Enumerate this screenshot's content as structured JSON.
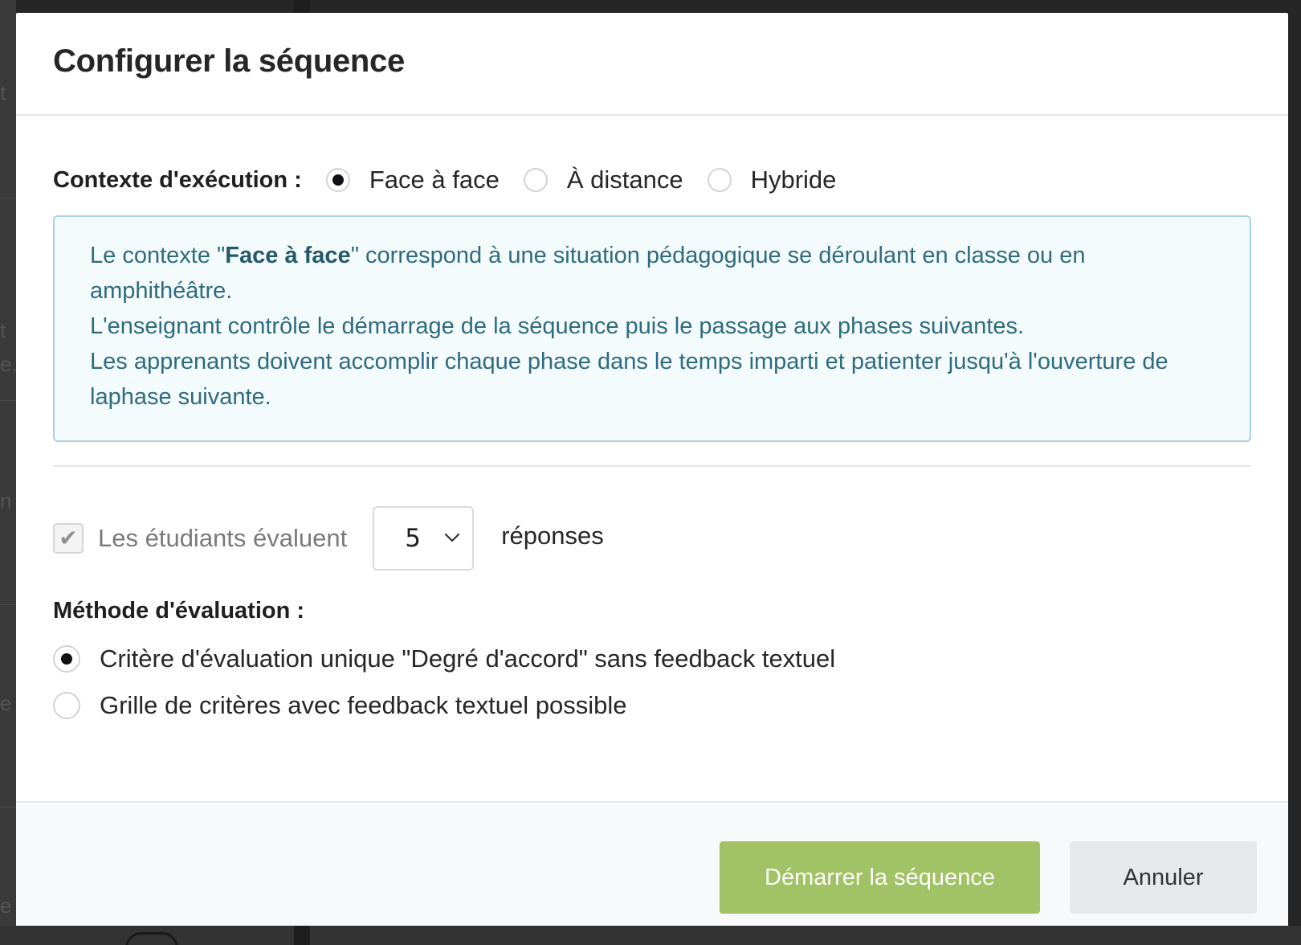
{
  "dialog": {
    "title": "Configurer la séquence"
  },
  "context": {
    "label": "Contexte d'exécution :",
    "options": [
      {
        "label": "Face à face",
        "checked": true
      },
      {
        "label": "À distance",
        "checked": false
      },
      {
        "label": "Hybride",
        "checked": false
      }
    ]
  },
  "info": {
    "line1_prefix": "Le contexte \"",
    "line1_strong": "Face à face",
    "line1_suffix": "\" correspond à une situation pédagogique se déroulant en classe ou en amphithéâtre.",
    "line2": "L'enseignant contrôle le démarrage de la séquence puis le passage aux phases suivantes.",
    "line3": "Les apprenants doivent accomplir chaque phase dans le temps imparti et patienter jusqu'à l'ouverture de laphase suivante."
  },
  "evaluation": {
    "checkbox_checked": true,
    "checkbox_label": "Les étudiants évaluent",
    "count_value": "5",
    "suffix": "réponses"
  },
  "method": {
    "label": "Méthode d'évaluation :",
    "options": [
      {
        "label": "Critère d'évaluation unique \"Degré d'accord\" sans feedback textuel",
        "checked": true
      },
      {
        "label": "Grille de critères avec feedback textuel possible",
        "checked": false
      }
    ]
  },
  "footer": {
    "start_label": "Démarrer la séquence",
    "cancel_label": "Annuler"
  },
  "colors": {
    "primary_button": "#a1c265",
    "info_text": "#2e6b7f",
    "info_border": "#a9d4dd"
  }
}
